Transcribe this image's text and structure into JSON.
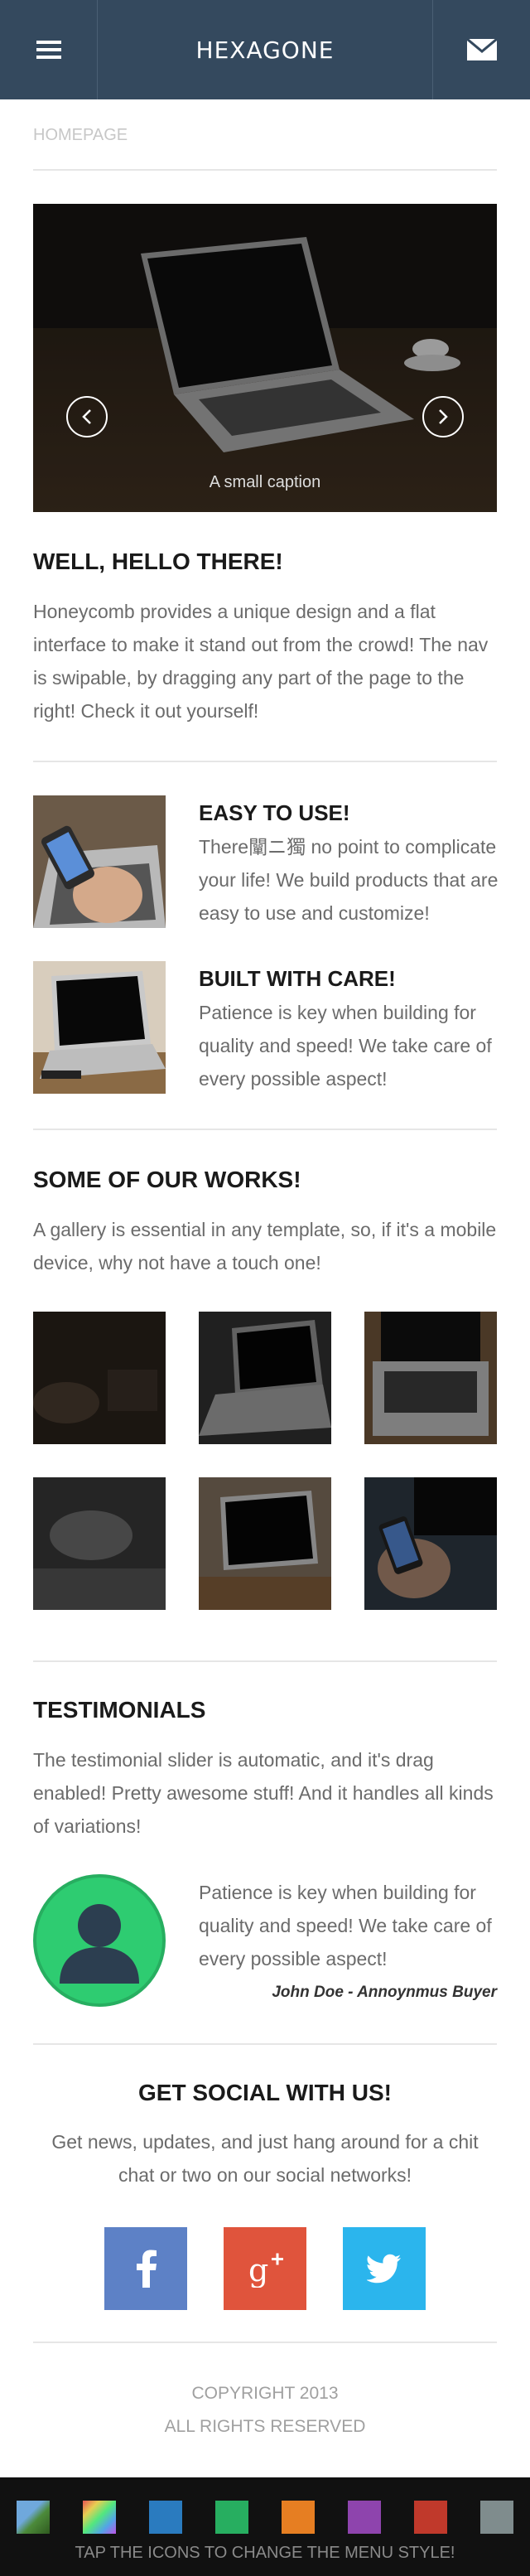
{
  "header": {
    "brand": "HEXAGONE",
    "menu_icon": "menu-icon",
    "mail_icon": "mail-icon",
    "color": "#34495e"
  },
  "breadcrumb": "HOMEPAGE",
  "slider": {
    "caption": "A small caption",
    "prev_icon": "chevron-left-icon",
    "next_icon": "chevron-right-icon"
  },
  "welcome": {
    "title": "WELL, HELLO THERE!",
    "body": "Honeycomb provides a unique design and a flat interface to make it stand out from the crowd! The nav is swipable, by dragging any part of the page to the right! Check it out yourself!"
  },
  "features": [
    {
      "title": "EASY TO USE!",
      "body": "There闡ニ獨 no point to complicate your life! We build products that are easy to use and customize!"
    },
    {
      "title": "BUILT WITH CARE!",
      "body": "Patience is key when building for quality and speed! We take care of every possible aspect!"
    }
  ],
  "works": {
    "title": "SOME OF OUR WORKS!",
    "body": "A gallery is essential in any template, so, if it's a mobile device, why not have a touch one!"
  },
  "testimonials": {
    "title": "TESTIMONIALS",
    "body": "The testimonial slider is automatic, and it's drag enabled! Pretty awesome stuff! And it handles all kinds of variations!",
    "quote": "Patience is key when building for quality and speed! We take care of every possible aspect!",
    "author": "John Doe - Annoynmus Buyer"
  },
  "social": {
    "title": "GET SOCIAL WITH US!",
    "body": "Get news, updates, and just hang around for a chit chat or two on our social networks!",
    "facebook_color": "#5d81c6",
    "googleplus_color": "#e0543c",
    "twitter_color": "#2bb5ed"
  },
  "copyright": {
    "line1": "COPYRIGHT 2013",
    "line2": "ALL RIGHTS RESERVED"
  },
  "footer": {
    "note": "TAP THE ICONS TO CHANGE THE MENU STYLE!",
    "swatches": [
      "#3a7a3a",
      "#ffffff",
      "#2a7bbf",
      "#27ae60",
      "#e67e22",
      "#8e44ad",
      "#c0392b",
      "#7f8c8d"
    ]
  }
}
